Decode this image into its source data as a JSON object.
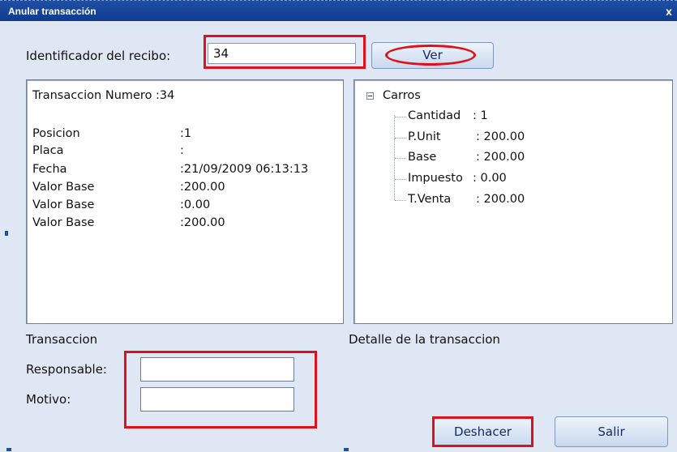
{
  "window": {
    "title": "Anular transacción",
    "close_glyph": "x"
  },
  "receipt": {
    "label": "Identificador del recibo:",
    "value": "34",
    "view_button": "Ver"
  },
  "transaction_panel": {
    "header": "Transaccion Numero :34",
    "rows": [
      {
        "label": "Posicion",
        "value": ":1"
      },
      {
        "label": "Placa",
        "value": ":"
      },
      {
        "label": "Fecha",
        "value": ":21/09/2009 06:13:13"
      },
      {
        "label": "Valor Base",
        "value": ":200.00"
      },
      {
        "label": "Valor Base",
        "value": ":0.00"
      },
      {
        "label": "Valor Base",
        "value": ":200.00"
      }
    ]
  },
  "detail_tree": {
    "root": "Carros",
    "expanded": true,
    "children": [
      {
        "label": "Cantidad",
        "value": ": 1"
      },
      {
        "label": "P.Unit",
        "value": ": 200.00"
      },
      {
        "label": "Base",
        "value": ": 200.00"
      },
      {
        "label": "Impuesto",
        "value": ": 0.00"
      },
      {
        "label": "T.Venta",
        "value": ": 200.00"
      }
    ]
  },
  "sections": {
    "transaction": "Transaccion",
    "detail": "Detalle de la transaccion"
  },
  "form": {
    "responsable_label": "Responsable:",
    "responsable_value": "",
    "motivo_label": "Motivo:",
    "motivo_value": ""
  },
  "buttons": {
    "undo": "Deshacer",
    "exit": "Salir"
  },
  "icons": {
    "tree_toggle": "minus-box-icon",
    "close": "close-icon"
  },
  "colors": {
    "titlebar": "#1f4fa6",
    "window_bg": "#dfe7f4",
    "highlight": "#e0101a",
    "button_text": "#1b2a66"
  }
}
